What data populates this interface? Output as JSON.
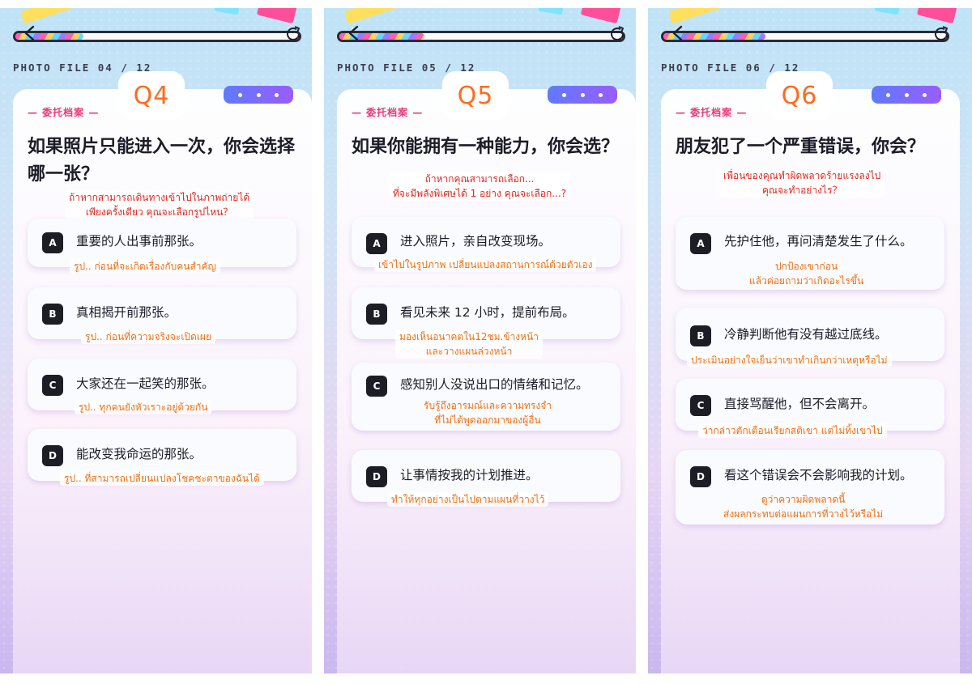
{
  "panels": [
    {
      "file_label": "PHOTO FILE 04 / 12",
      "tag": "— 委托档案 —",
      "q": "Q4",
      "title": "如果照片只能进入一次，你会选择哪一张？",
      "note_line1": "ถ้าหากสามารถเดินทางเข้าไปในภาพถ่ายได้",
      "note_line2": "เพียงครั้งเดียว คุณจะเลือกรูปไหน？",
      "progress_pct": 24,
      "options": [
        {
          "letter": "A",
          "text": "重要的人出事前那张。",
          "note": "รูป.. ก่อนที่จะเกิดเรื่องกับคนสำคัญ"
        },
        {
          "letter": "B",
          "text": "真相揭开前那张。",
          "note": "รูป.. ก่อนที่ความจริงจะเปิดเผย"
        },
        {
          "letter": "C",
          "text": "大家还在一起笑的那张。",
          "note": "รูป.. ทุกคนยังหัวเราะอยู่ด้วยกัน"
        },
        {
          "letter": "D",
          "text": "能改变我命运的那张。",
          "note": "รูป.. ที่สามารถเปลี่ยนแปลงโชคชะตาของฉันได้"
        }
      ]
    },
    {
      "file_label": "PHOTO FILE 05 / 12",
      "tag": "— 委托档案 —",
      "q": "Q5",
      "title": "如果你能拥有一种能力，你会选？",
      "note_line1": "ถ้าหากคุณสามารถเลือก...",
      "note_line2": "ที่จะมีพลังพิเศษได้ 1 อย่าง คุณจะเลือก...?",
      "progress_pct": 30,
      "options": [
        {
          "letter": "A",
          "text": "进入照片，亲自改变现场。",
          "note": "เข้าไปในรูปภาพ เปลี่ยนแปลงสถานการณ์ด้วยตัวเอง"
        },
        {
          "letter": "B",
          "text": "看见未来 12 小时，提前布局。",
          "note": "มองเห็นอนาคตใน12ชม.ข้างหน้า",
          "note2": "และวางแผนล่วงหน้า"
        },
        {
          "letter": "C",
          "text": "感知别人没说出口的情绪和记忆。",
          "note": "รับรู้ถึงอารมณ์และความทรงจำ",
          "note2": "ที่ไม่ได้พูดออกมาของผู้อื่น"
        },
        {
          "letter": "D",
          "text": "让事情按我的计划推进。",
          "note": "ทำให้ทุกอย่างเป็นไปตามแผนที่วางไว้"
        }
      ]
    },
    {
      "file_label": "PHOTO FILE 06 / 12",
      "tag": "— 委托档案 —",
      "q": "Q6",
      "title": "朋友犯了一个严重错误，你会？",
      "note_line1": "เพื่อนของคุณทำผิดพลาดร้ายแรงลงไป",
      "note_line2": "คุณจะทำอย่างไร？",
      "progress_pct": 36,
      "options": [
        {
          "letter": "A",
          "text": "先护住他，再问清楚发生了什么。",
          "note": "ปกป้องเขาก่อน",
          "note2": "แล้วค่อยถามว่าเกิดอะไรขึ้น"
        },
        {
          "letter": "B",
          "text": "冷静判断他有没有越过底线。",
          "note": "ประเมินอย่างใจเย็นว่าเขาทำเกินกว่าเหตุหรือไม่"
        },
        {
          "letter": "C",
          "text": "直接骂醒他，但不会离开。",
          "note": "ว่ากล่าวตักเตือนเรียกสติเขา แต่ไม่ทิ้งเขาไป"
        },
        {
          "letter": "D",
          "text": "看这个错误会不会影响我的计划。",
          "note": "ดูว่าความผิดพลาดนี้",
          "note2": "ส่งผลกระทบต่อแผนการที่วางไว้หรือไม่"
        }
      ]
    }
  ]
}
